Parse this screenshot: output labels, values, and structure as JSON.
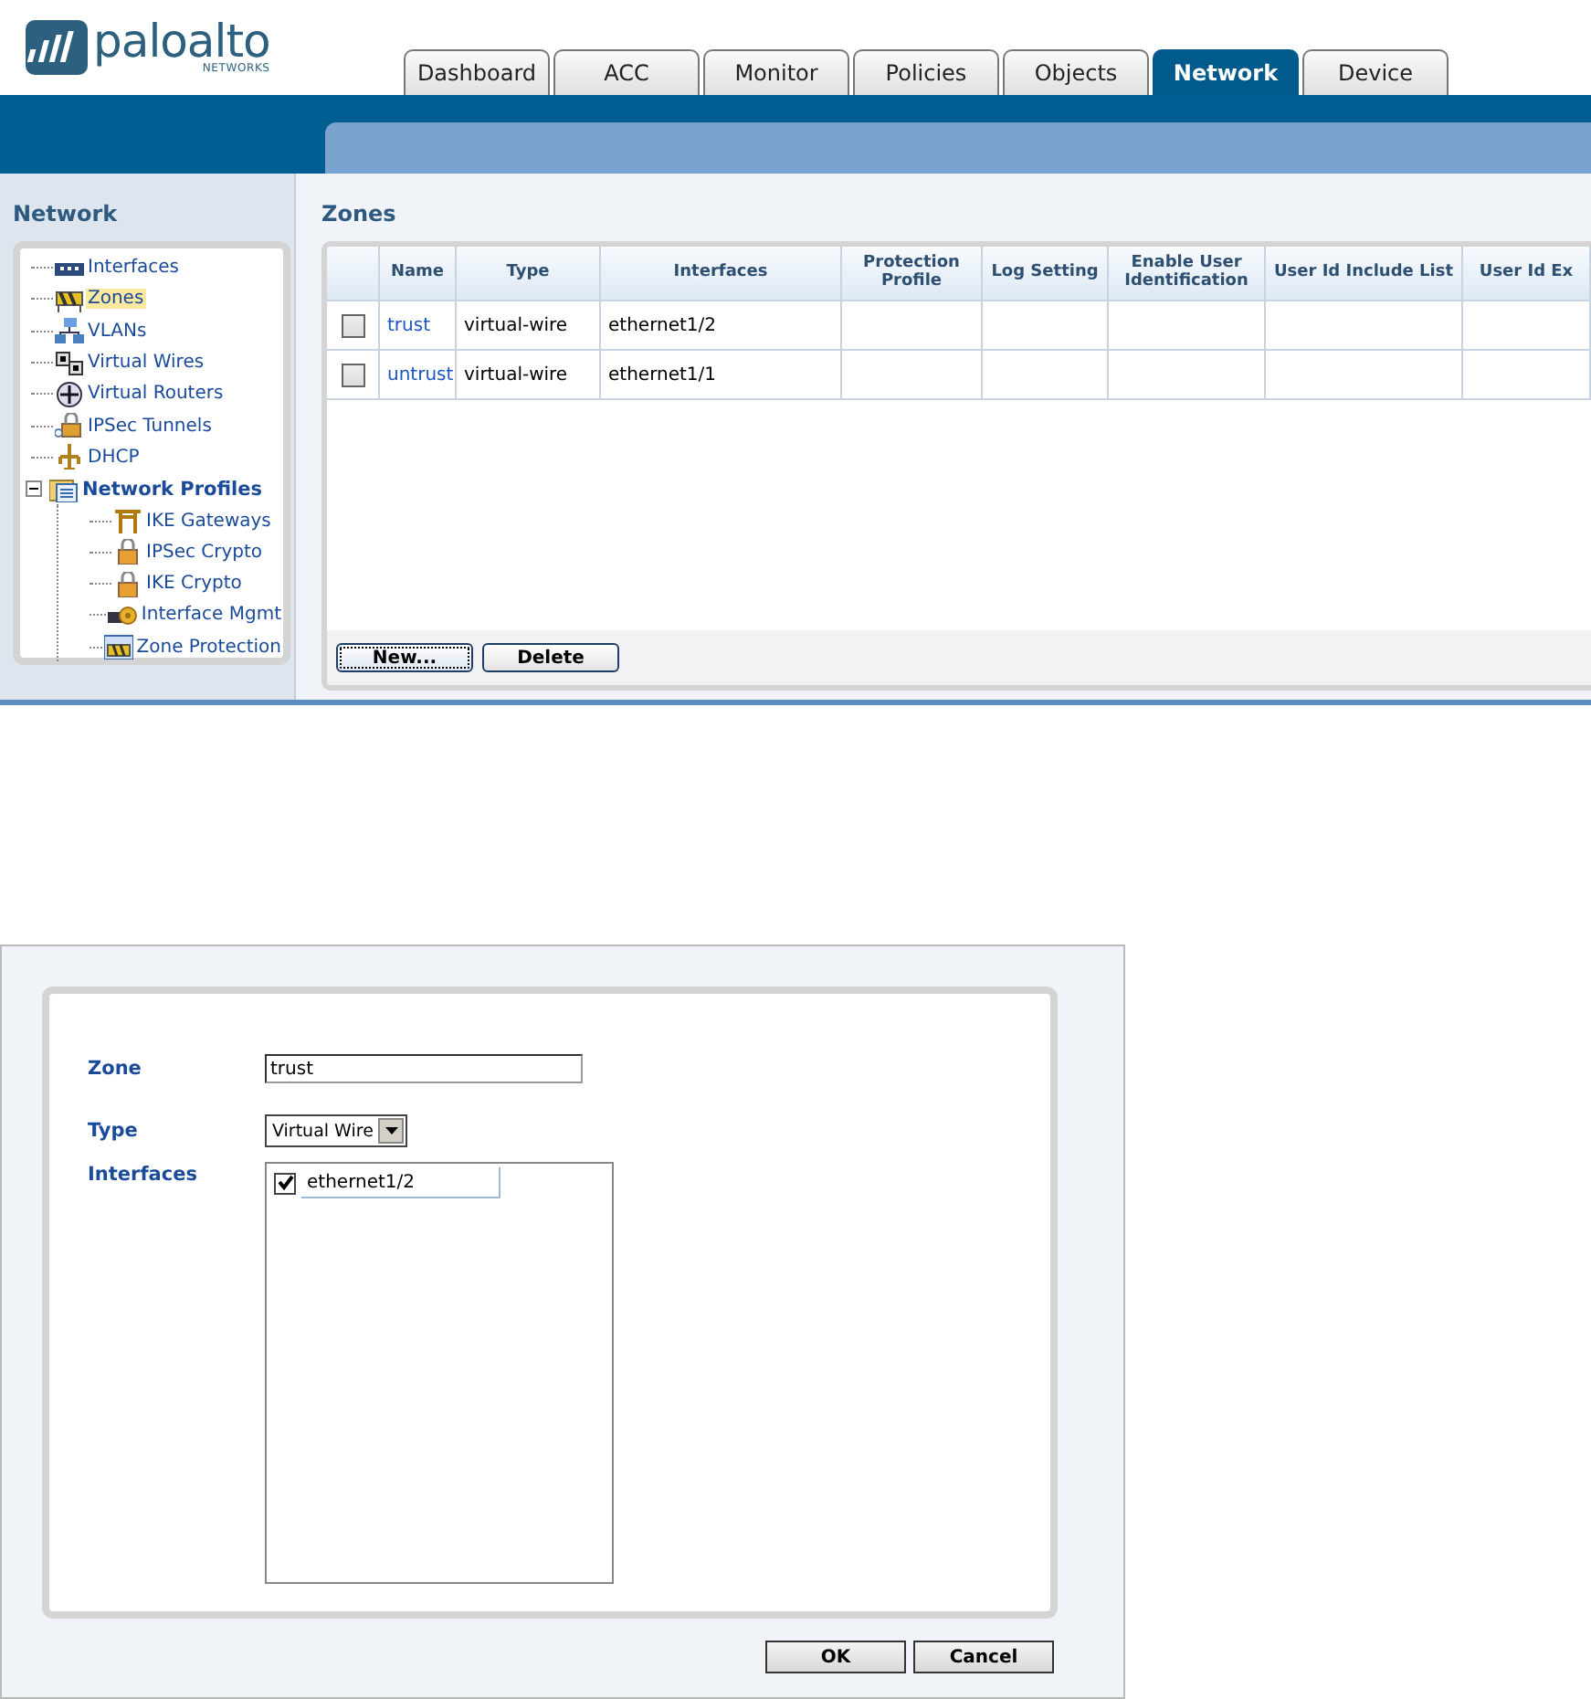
{
  "header": {
    "logo": {
      "name": "paloalto",
      "sub": "NETWORKS"
    },
    "tabs": [
      {
        "label": "Dashboard",
        "selected": false
      },
      {
        "label": "ACC",
        "selected": false
      },
      {
        "label": "Monitor",
        "selected": false
      },
      {
        "label": "Policies",
        "selected": false
      },
      {
        "label": "Objects",
        "selected": false
      },
      {
        "label": "Network",
        "selected": true
      },
      {
        "label": "Device",
        "selected": false
      }
    ]
  },
  "sidebar": {
    "title": "Network",
    "items": [
      {
        "label": "Interfaces",
        "selected": false
      },
      {
        "label": "Zones",
        "selected": true
      },
      {
        "label": "VLANs",
        "selected": false
      },
      {
        "label": "Virtual Wires",
        "selected": false
      },
      {
        "label": "Virtual Routers",
        "selected": false
      },
      {
        "label": "IPSec Tunnels",
        "selected": false
      },
      {
        "label": "DHCP",
        "selected": false
      },
      {
        "label": "Network Profiles",
        "selected": false,
        "expanded": true,
        "children": [
          {
            "label": "IKE Gateways",
            "selected": false
          },
          {
            "label": "IPSec Crypto",
            "selected": false
          },
          {
            "label": "IKE Crypto",
            "selected": false
          },
          {
            "label": "Interface Mgmt",
            "selected": false
          },
          {
            "label": "Zone Protection",
            "selected": false
          }
        ]
      }
    ]
  },
  "main": {
    "title": "Zones",
    "table": {
      "columns": [
        "Name",
        "Type",
        "Interfaces",
        "Protection Profile",
        "Log Setting",
        "Enable User Identification",
        "User Id Include List",
        "User Id Ex"
      ],
      "rows": [
        {
          "checked": false,
          "cells": [
            "trust",
            "virtual-wire",
            "ethernet1/2"
          ]
        },
        {
          "checked": false,
          "cells": [
            "untrust",
            "virtual-wire",
            "ethernet1/1"
          ]
        }
      ]
    },
    "buttons": [
      "New...",
      "Delete"
    ]
  },
  "dialog": {
    "zone": {
      "label": "Zone",
      "value": "trust"
    },
    "type": {
      "label": "Type",
      "value": "Virtual Wire"
    },
    "interfaces": {
      "label": "Interfaces",
      "items": [
        {
          "label": "ethernet1/2",
          "checked": true
        }
      ]
    },
    "buttons": [
      "OK",
      "Cancel"
    ]
  }
}
